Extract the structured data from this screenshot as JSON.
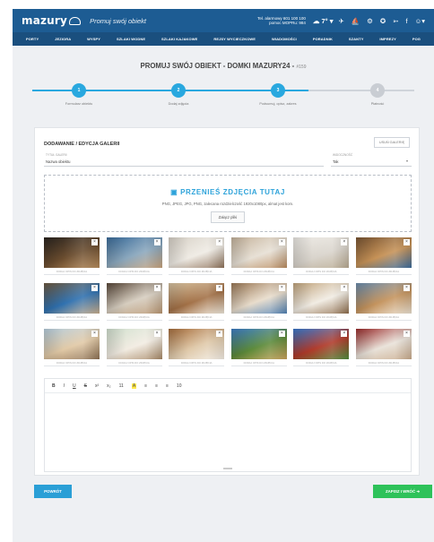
{
  "header": {
    "logo": "mazury",
    "promo_link": "Promuj swój obiekt",
    "phone_line1": "Tel. alarmowy 601 100 100",
    "phone_line2": "pomoc MOPRu: 984",
    "weather": "7°",
    "icons": [
      "cloud-icon",
      "chevron-down-icon",
      "plane-icon",
      "sailboat-icon",
      "bike-icon",
      "settings-icon",
      "fish-icon",
      "facebook-icon",
      "user-icon"
    ]
  },
  "nav": {
    "items": [
      "PORTY",
      "JEZIORA",
      "WYSPY",
      "SZLAKI WODNE",
      "SZLAKI KAJAKOWE",
      "REJSY WYCIECZKOWE",
      "WIADOMOŚCI",
      "PORADNIK",
      "SZANTY",
      "IMPREZY",
      "POG"
    ]
  },
  "page": {
    "title": "PROMUJ SWÓJ OBIEKT - DOMKI MAZURY24 -",
    "title_number": "#159"
  },
  "steps": [
    {
      "num": "1",
      "label": "Formularz obiektu",
      "active": true
    },
    {
      "num": "2",
      "label": "Dodaj zdjęcia",
      "active": true
    },
    {
      "num": "3",
      "label": "Podsumuj, opisz, zakres",
      "active": true
    },
    {
      "num": "4",
      "label": "Płatność",
      "active": false
    }
  ],
  "gallery": {
    "heading": "DODAWANIE / EDYCJA GALERII",
    "delete_button": "USUŃ GALERIĘ",
    "title_label": "TYTUŁ GALERII",
    "title_value": "Nazwa obiektu",
    "visible_label": "WIDOCZNOŚĆ",
    "visible_value": "Tak",
    "dropzone_title": "PRZENIEŚ ZDJĘCIA TUTAJ",
    "dropzone_info": "PNG, JPEG, JPG, PNG, zalecana rozdzielczość 1920x1080px, almat jest kom.",
    "dropzone_button": "Załącz pliki",
    "caption_placeholder": "DODAJ OPIS DO ZDJĘCIA",
    "delete_icon": "×",
    "photos": [
      {
        "colors": [
          "#2b2520",
          "#6b4d2f",
          "#b58a5a"
        ]
      },
      {
        "colors": [
          "#3d6e9c",
          "#8aa7bd",
          "#c7a27a"
        ]
      },
      {
        "colors": [
          "#d8d2c8",
          "#efebe4",
          "#8c7058"
        ]
      },
      {
        "colors": [
          "#c7b59e",
          "#e7e0d5",
          "#b88a5e"
        ]
      },
      {
        "colors": [
          "#f0ede8",
          "#d9d4cc",
          "#b7a88f"
        ]
      },
      {
        "colors": [
          "#7a5634",
          "#c69257",
          "#3a6a9c"
        ]
      },
      {
        "colors": [
          "#6f5b42",
          "#2f71b0",
          "#c7ad8c"
        ]
      },
      {
        "colors": [
          "#5b4a3c",
          "#d6cdbf",
          "#b89570"
        ]
      },
      {
        "colors": [
          "#d8c4a3",
          "#a27046",
          "#ece5d8"
        ]
      },
      {
        "colors": [
          "#9c7a58",
          "#e8dccb",
          "#4f80b3"
        ]
      },
      {
        "colors": [
          "#c2a57e",
          "#f1ece3",
          "#8c6b4a"
        ]
      },
      {
        "colors": [
          "#6d8fb0",
          "#c4935d",
          "#e9dfcf"
        ]
      },
      {
        "colors": [
          "#b8d0e0",
          "#e1c9a6",
          "#8c6f52"
        ]
      },
      {
        "colors": [
          "#d2e1d0",
          "#f2ece2",
          "#a58664"
        ]
      },
      {
        "colors": [
          "#a86f3e",
          "#dfc8a8",
          "#f1ebe2"
        ]
      },
      {
        "colors": [
          "#3f7fc8",
          "#5c8a3a",
          "#c9a25a"
        ]
      },
      {
        "colors": [
          "#3a7bd0",
          "#b03a2a",
          "#4e8a3a"
        ]
      },
      {
        "colors": [
          "#9b2d2d",
          "#e9e2d9",
          "#c7a98a"
        ]
      }
    ]
  },
  "editor": {
    "toolbar": [
      "B",
      "I",
      "U",
      "S",
      "x²",
      "x₂",
      "11",
      "A",
      "≡",
      "≡",
      "≡",
      "10"
    ]
  },
  "actions": {
    "back": "POWRÓT",
    "save": "ZAPISZ I WRÓĆ ➜"
  },
  "colors": {
    "topbar": "#1d5c93",
    "navbar": "#1a4f7e",
    "accent": "#29a8df",
    "save": "#2ec25a"
  }
}
